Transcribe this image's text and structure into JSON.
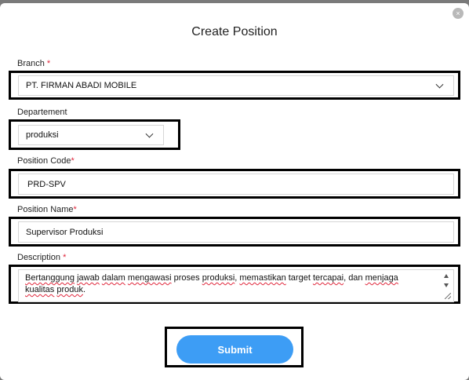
{
  "modal": {
    "title": "Create Position",
    "close_glyph": "×"
  },
  "form": {
    "branch": {
      "label": "Branch",
      "required_mark": "*",
      "value": "PT. FIRMAN ABADI MOBILE"
    },
    "departement": {
      "label": "Departement",
      "value": "produksi"
    },
    "position_code": {
      "label": "Position Code",
      "required_mark": "*",
      "value": "PRD-SPV"
    },
    "position_name": {
      "label": "Position Name",
      "required_mark": "*",
      "value": "Supervisor Produksi"
    },
    "description": {
      "label": "Description",
      "required_mark": "*",
      "value_parts": [
        "Bertanggung",
        " ",
        "jawab",
        " ",
        "dalam",
        " ",
        "mengawasi",
        " proses ",
        "produksi",
        ", ",
        "memastikan",
        " target ",
        "tercapai",
        ", dan ",
        "menjaga",
        " ",
        "kualitas",
        " ",
        "produk",
        "."
      ]
    },
    "submit_label": "Submit"
  },
  "colors": {
    "accent": "#3d9df5",
    "required": "#e0263b",
    "overlay": "#7a7a7a"
  },
  "icons": {
    "close": "close-icon",
    "dropdown": "chevron-down-icon",
    "scroll_up": "arrow-up-icon",
    "scroll_down": "arrow-down-icon",
    "resize": "resize-handle-icon"
  }
}
